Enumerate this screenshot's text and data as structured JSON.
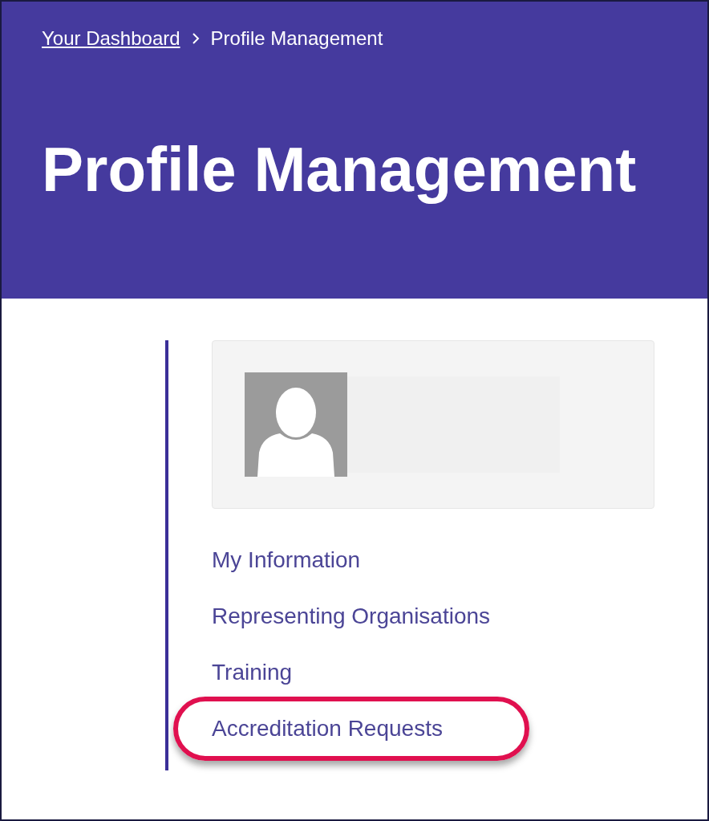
{
  "breadcrumb": [
    {
      "label": "Your Dashboard",
      "kind": "link"
    },
    {
      "label": "Profile Management",
      "kind": "current"
    }
  ],
  "header": {
    "title": "Profile Management"
  },
  "nav": [
    {
      "label": "My Information",
      "highlighted": false
    },
    {
      "label": "Representing Organisations",
      "highlighted": false
    },
    {
      "label": "Training",
      "highlighted": false
    },
    {
      "label": "Accreditation Requests",
      "highlighted": true
    }
  ]
}
